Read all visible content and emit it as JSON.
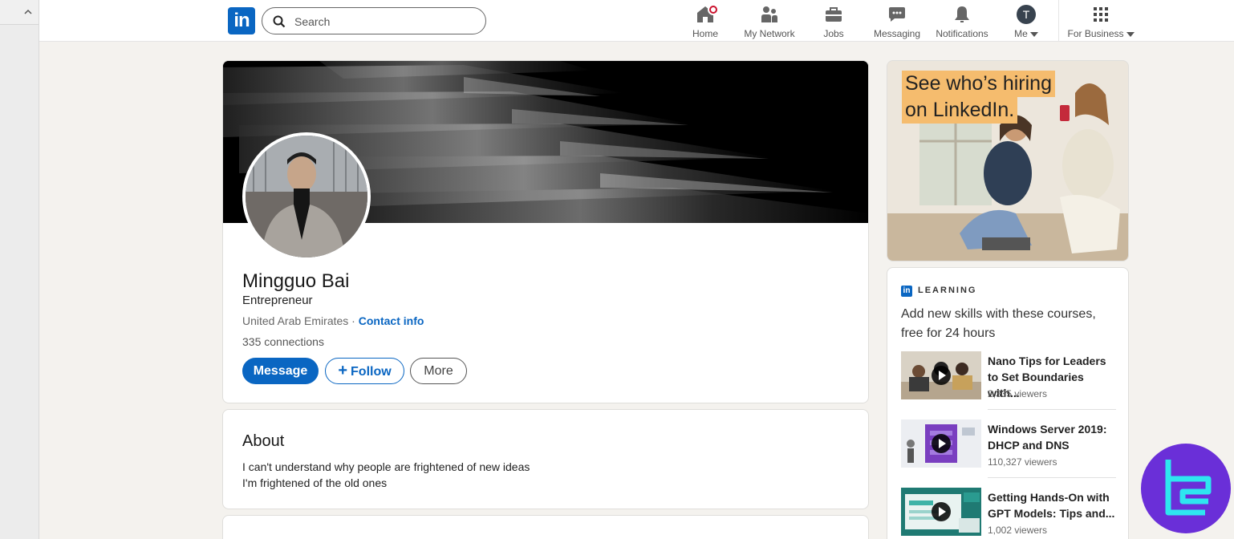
{
  "nav": {
    "logo": "in",
    "search_placeholder": "Search",
    "items": [
      {
        "label": "Home"
      },
      {
        "label": "My Network"
      },
      {
        "label": "Jobs"
      },
      {
        "label": "Messaging"
      },
      {
        "label": "Notifications"
      },
      {
        "label": "Me"
      },
      {
        "label": "For Business"
      }
    ],
    "me_initial": "T"
  },
  "profile": {
    "name": "Mingguo Bai",
    "headline": "Entrepreneur",
    "location": "United Arab Emirates",
    "separator": " · ",
    "contact_info": "Contact info",
    "connections": "335 connections",
    "buttons": {
      "message": "Message",
      "follow": "Follow",
      "more": "More"
    }
  },
  "about": {
    "title": "About",
    "lines": [
      "I can't understand why people are frightened of new ideas",
      "I'm frightened of the old ones"
    ]
  },
  "ad": {
    "line1": "See who’s hiring",
    "line2": "on LinkedIn."
  },
  "learning": {
    "label": "LEARNING",
    "subtitle": "Add new skills with these courses, free for 24 hours",
    "courses": [
      {
        "title": "Nano Tips for Leaders to Set Boundaries with...",
        "viewers": "2,335 viewers"
      },
      {
        "title": "Windows Server 2019: DHCP and DNS",
        "viewers": "110,327 viewers"
      },
      {
        "title": "Getting Hands-On with GPT Models: Tips and...",
        "viewers": "1,002 viewers"
      }
    ]
  },
  "colors": {
    "brand": "#0a66c2",
    "notification": "#cb112d",
    "watermark": "#6a2fd8",
    "watermark_accent": "#2ee6f0"
  },
  "icons": [
    "home-icon",
    "network-icon",
    "jobs-icon",
    "messaging-icon",
    "notifications-icon",
    "grid-icon",
    "search-icon"
  ]
}
